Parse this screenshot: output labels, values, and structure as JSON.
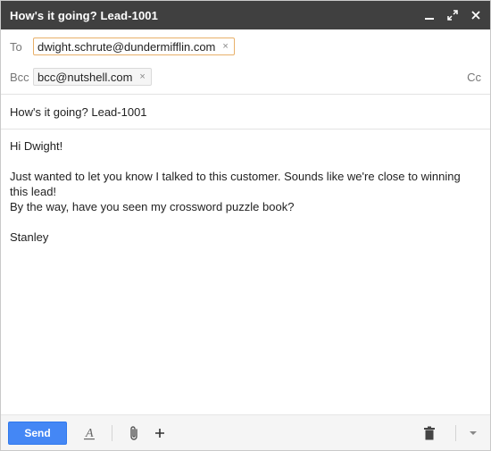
{
  "window": {
    "title": "How's it going? Lead-1001",
    "icons": [
      "minimize-icon",
      "expand-icon",
      "close-icon"
    ]
  },
  "recipients": {
    "to_label": "To",
    "to_address": "dwight.schrute@dundermifflin.com",
    "bcc_label": "Bcc",
    "bcc_address": "bcc@nutshell.com",
    "remove_glyph": "×",
    "cc_label": "Cc"
  },
  "subject": "How's it going? Lead-1001",
  "message": {
    "greeting": "Hi Dwight!",
    "paragraph_line1": "Just wanted to let you know I talked to this customer. Sounds like we're close to winning this lead!",
    "paragraph_line2": "By the way, have you seen my crossword puzzle book?",
    "signature": "Stanley"
  },
  "toolbar": {
    "send_label": "Send",
    "icons": [
      "text-format-icon",
      "paperclip-icon",
      "plus-icon",
      "trash-icon",
      "more-options-icon"
    ],
    "colors": {
      "send": "#4487f5",
      "titlebar": "#404040"
    }
  }
}
